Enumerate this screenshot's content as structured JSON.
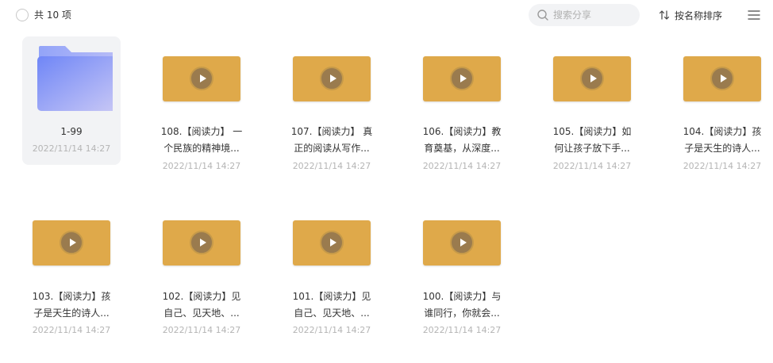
{
  "header": {
    "count_label": "共 10 项",
    "search_placeholder": "搜索分享",
    "sort_label": "按名称排序"
  },
  "items": [
    {
      "type": "folder",
      "name_line1": "1-99",
      "name_line2": "",
      "date": "2022/11/14 14:27"
    },
    {
      "type": "video",
      "name_line1": "108.【阅读力】 一",
      "name_line2": "个民族的精神境...",
      "date": "2022/11/14 14:27"
    },
    {
      "type": "video",
      "name_line1": "107.【阅读力】 真",
      "name_line2": "正的阅读从写作...",
      "date": "2022/11/14 14:27"
    },
    {
      "type": "video",
      "name_line1": "106.【阅读力】教",
      "name_line2": "育奠基，从深度...",
      "date": "2022/11/14 14:27"
    },
    {
      "type": "video",
      "name_line1": "105.【阅读力】如",
      "name_line2": "何让孩子放下手...",
      "date": "2022/11/14 14:27"
    },
    {
      "type": "video",
      "name_line1": "104.【阅读力】孩",
      "name_line2": "子是天生的诗人...",
      "date": "2022/11/14 14:27"
    },
    {
      "type": "video",
      "name_line1": "103.【阅读力】孩",
      "name_line2": "子是天生的诗人...",
      "date": "2022/11/14 14:27"
    },
    {
      "type": "video",
      "name_line1": "102.【阅读力】见",
      "name_line2": "自己、见天地、...",
      "date": "2022/11/14 14:27"
    },
    {
      "type": "video",
      "name_line1": "101.【阅读力】见",
      "name_line2": "自己、见天地、...",
      "date": "2022/11/14 14:27"
    },
    {
      "type": "video",
      "name_line1": "100.【阅读力】与",
      "name_line2": "谁同行，你就会...",
      "date": "2022/11/14 14:27"
    }
  ],
  "colors": {
    "video_thumb": "#dfa94a",
    "folder_gradient_start": "#6f86f7",
    "folder_gradient_end": "#c9c8f5",
    "card_bg": "#f2f3f5"
  }
}
